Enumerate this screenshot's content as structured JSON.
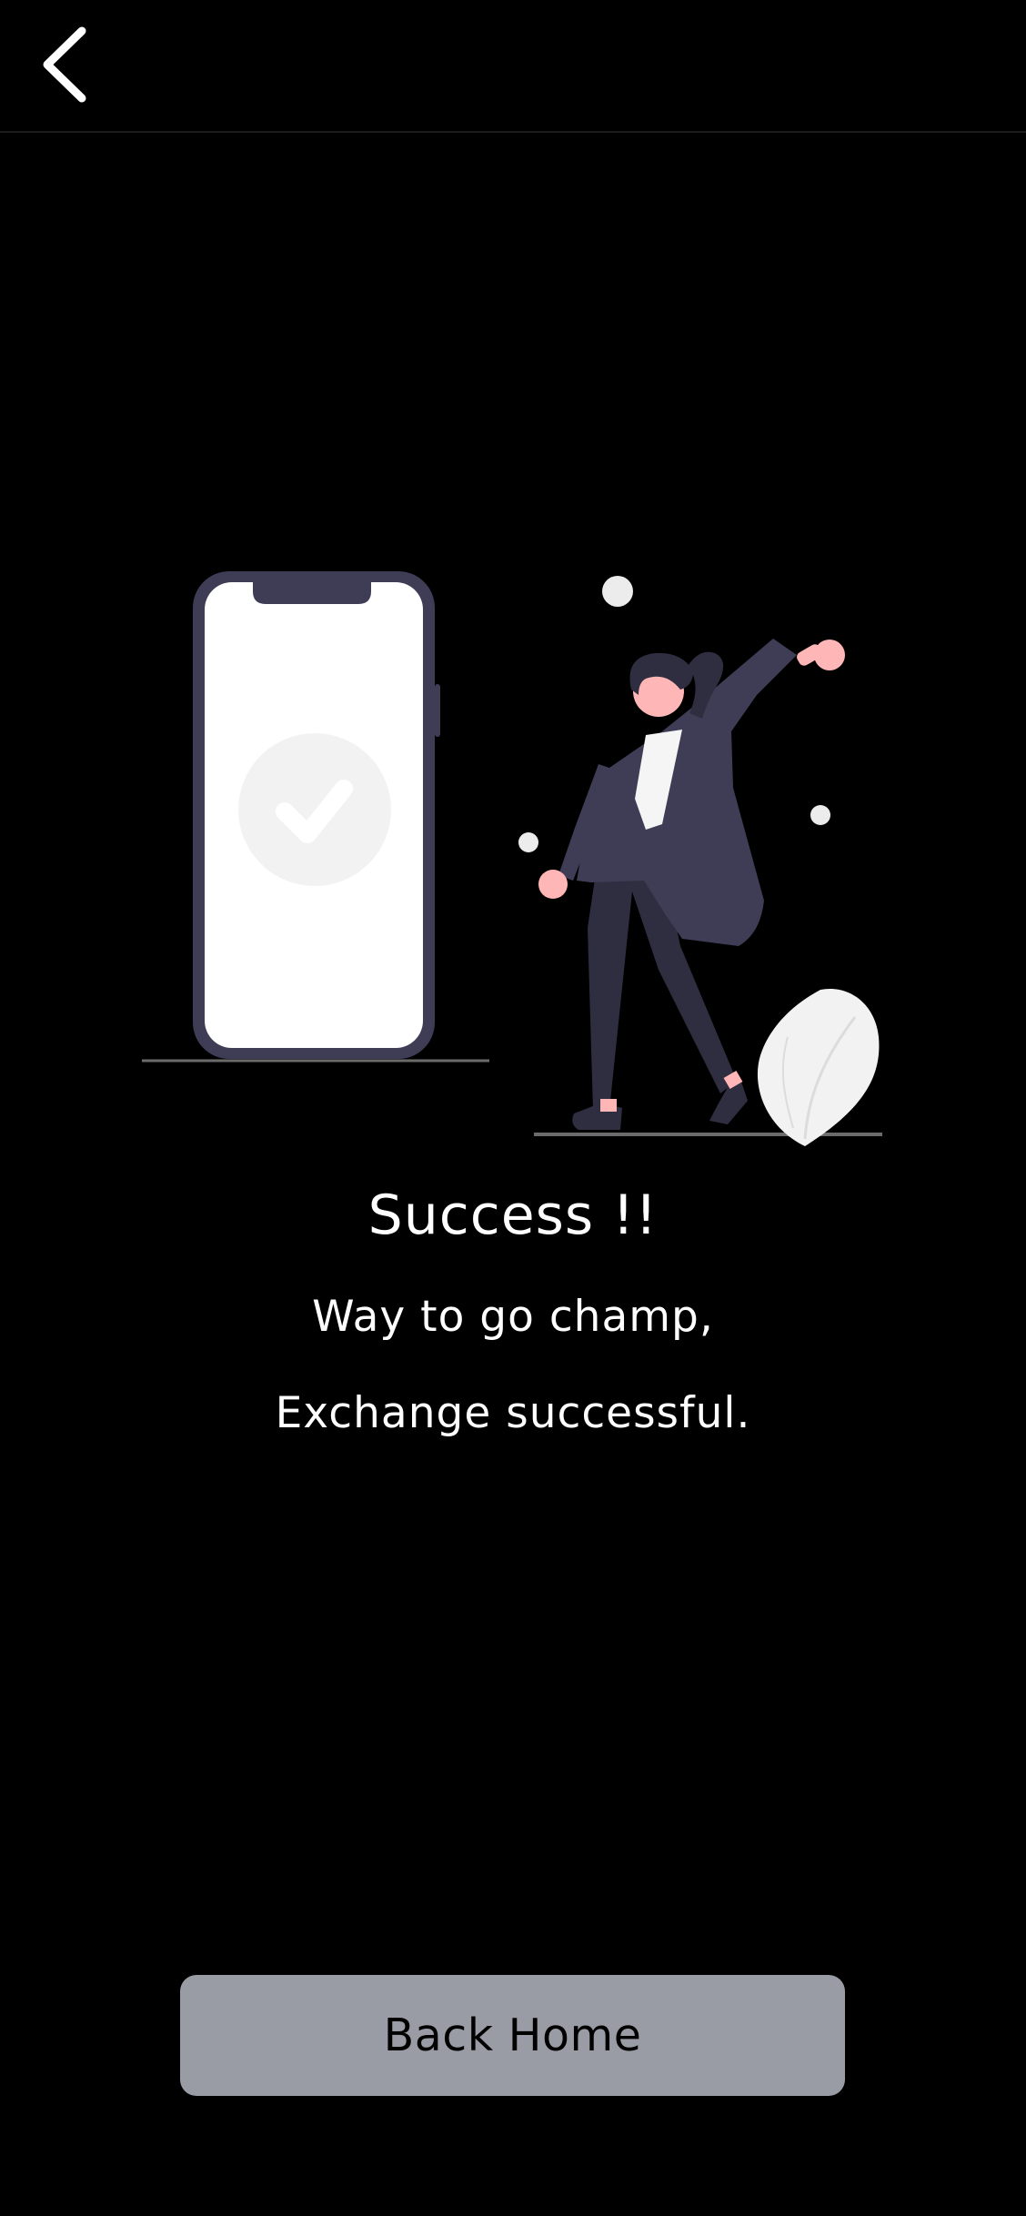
{
  "header": {
    "back_icon": "chevron-left-icon"
  },
  "illustration": {
    "description_icon": "success-illustration",
    "accent_color": "#3f3d56",
    "light_color": "#f2f2f2",
    "skin_color": "#ffb6b6"
  },
  "message": {
    "title": "Success !!",
    "line1": "Way to go champ,",
    "line2": "Exchange successful."
  },
  "actions": {
    "back_home_label": "Back Home",
    "button_color": "#999ca5"
  }
}
